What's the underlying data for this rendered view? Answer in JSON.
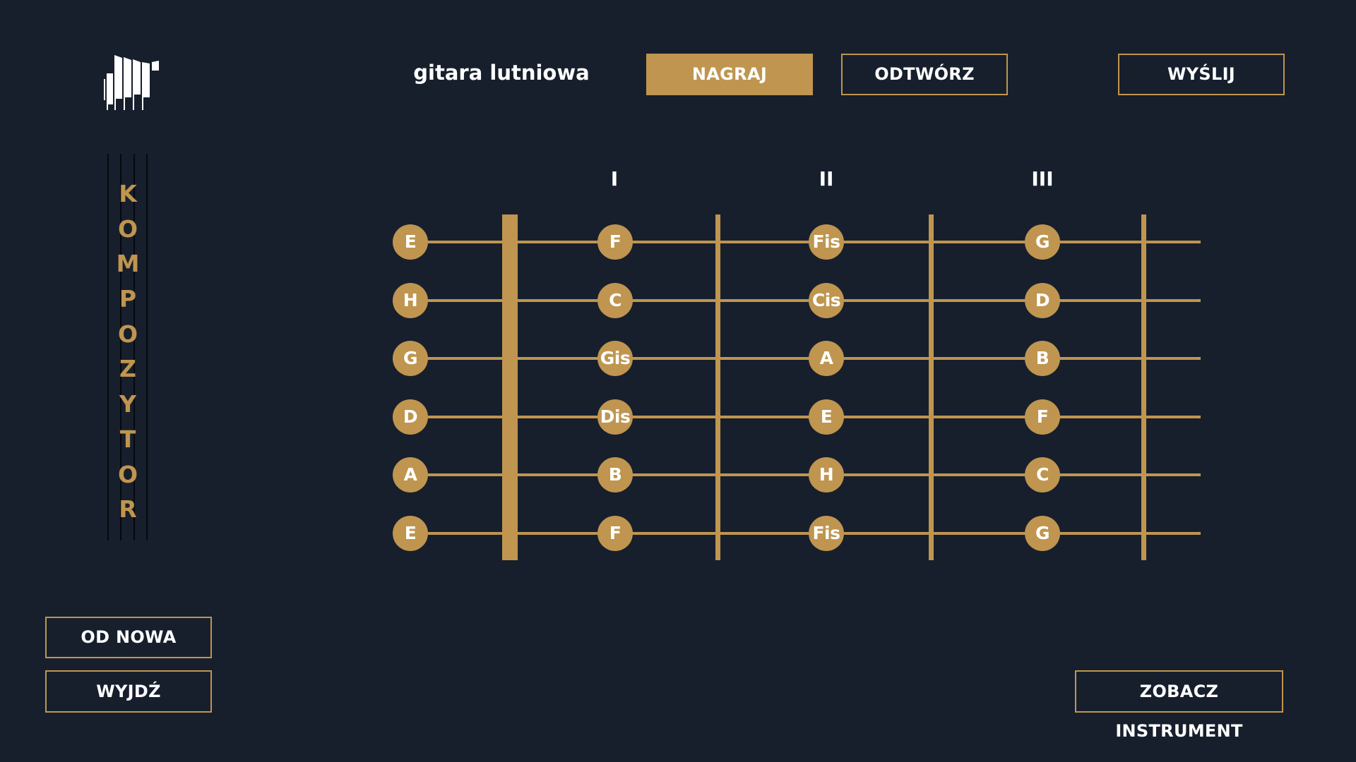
{
  "header": {
    "instrument_name": "gitara lutniowa",
    "record_label": "NAGRAJ",
    "play_label": "ODTWÓRZ",
    "send_label": "WYŚLIJ"
  },
  "sidebar": {
    "title_letters": [
      "K",
      "O",
      "M",
      "P",
      "O",
      "Z",
      "Y",
      "T",
      "O",
      "R"
    ],
    "reset_label": "OD NOWA",
    "exit_label": "WYJDŹ"
  },
  "footer": {
    "view_instrument_label": "ZOBACZ INSTRUMENT"
  },
  "fretboard": {
    "fret_labels": [
      "I",
      "II",
      "III"
    ],
    "strings": [
      {
        "open": "E",
        "frets": [
          "F",
          "Fis",
          "G"
        ]
      },
      {
        "open": "H",
        "frets": [
          "C",
          "Cis",
          "D"
        ]
      },
      {
        "open": "G",
        "frets": [
          "Gis",
          "A",
          "B"
        ]
      },
      {
        "open": "D",
        "frets": [
          "Dis",
          "E",
          "F"
        ]
      },
      {
        "open": "A",
        "frets": [
          "B",
          "H",
          "C"
        ]
      },
      {
        "open": "E",
        "frets": [
          "F",
          "Fis",
          "G"
        ]
      }
    ]
  },
  "colors": {
    "background": "#171f2d",
    "accent": "#bf954f",
    "text": "#ffffff"
  },
  "icons": {
    "logo": "organ-pipes-logo-icon"
  }
}
